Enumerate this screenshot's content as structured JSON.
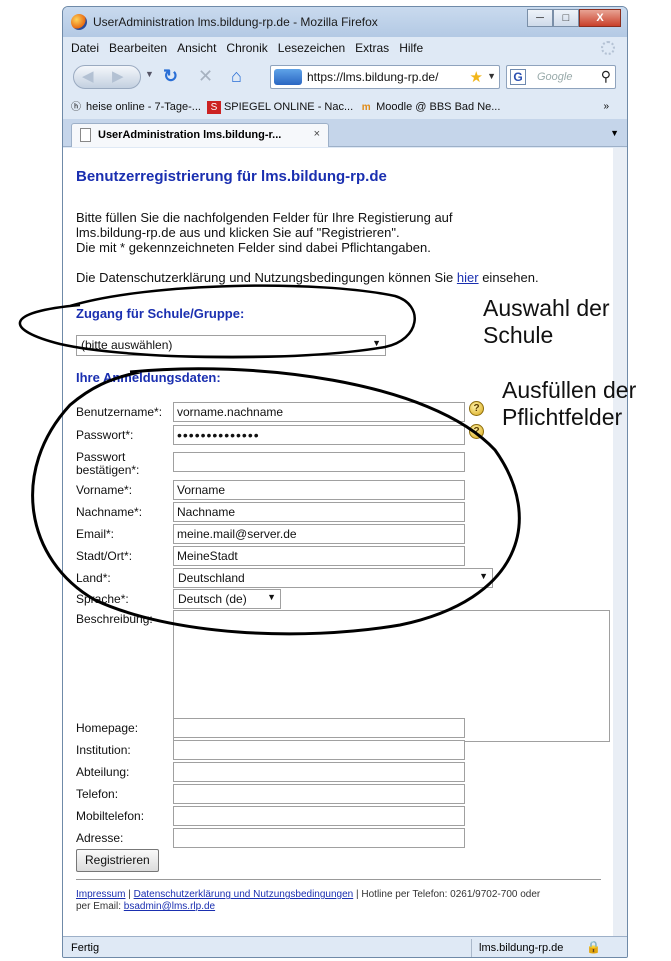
{
  "window": {
    "title": "UserAdministration lms.bildung-rp.de - Mozilla Firefox",
    "controls": [
      "─",
      "□",
      "X"
    ]
  },
  "menubar": {
    "items": [
      {
        "label": "Datei"
      },
      {
        "label": "Bearbeiten"
      },
      {
        "label": "Ansicht"
      },
      {
        "label": "Chronik"
      },
      {
        "label": "Lesezeichen"
      },
      {
        "label": "Extras"
      },
      {
        "label": "Hilfe"
      }
    ]
  },
  "navbar": {
    "url": "https://lms.bildung-rp.de/",
    "search_placeholder": "Google"
  },
  "bookmarks": [
    {
      "label": "heise online - 7-Tage-..."
    },
    {
      "label": "SPIEGEL ONLINE - Nac..."
    },
    {
      "label": "Moodle @ BBS Bad Ne..."
    }
  ],
  "bookmarks_more": "»",
  "tab": {
    "title": "UserAdministration lms.bildung-r...",
    "close": "×"
  },
  "page": {
    "heading": "Benutzerregistrierung für lms.bildung-rp.de",
    "intro_lines": [
      "Bitte füllen Sie die nachfolgenden Felder für Ihre Registierung auf",
      "lms.bildung-rp.de aus und klicken Sie auf \"Registrieren\".",
      "Die mit * gekennzeichneten Felder sind dabei Pflichtangaben."
    ],
    "privacy_text": "Die Datenschutzerklärung und Nutzungsbedingungen können Sie",
    "privacy_link": "hier",
    "privacy_suffix": "einsehen.",
    "school_heading": "Zugang für Schule/Gruppe:",
    "school_select": "(bitte auswählen)",
    "login_heading": "Ihre Anmeldungsdaten:",
    "fields": {
      "username": {
        "label": "Benutzername*:",
        "value": "vorname.nachname"
      },
      "password": {
        "label": "Passwort*:",
        "value": "••••••••••••••"
      },
      "password_confirm": {
        "label_1": "Passwort",
        "label_2": "bestätigen*:",
        "value": ""
      },
      "firstname": {
        "label": "Vorname*:",
        "value": "Vorname"
      },
      "lastname": {
        "label": "Nachname*:",
        "value": "Nachname"
      },
      "email": {
        "label": "Email*:",
        "value": "meine.mail@server.de"
      },
      "city": {
        "label": "Stadt/Ort*:",
        "value": "MeineStadt"
      },
      "country": {
        "label": "Land*:",
        "value": "Deutschland"
      },
      "language": {
        "label": "Sprache*:",
        "value": "Deutsch (de)"
      },
      "description": {
        "label": "Beschreibung:"
      },
      "homepage": {
        "label": "Homepage:"
      },
      "institution": {
        "label": "Institution:"
      },
      "department": {
        "label": "Abteilung:"
      },
      "phone": {
        "label": "Telefon:"
      },
      "mobile": {
        "label": "Mobiltelefon:"
      },
      "address": {
        "label": "Adresse:"
      }
    },
    "submit_label": "Registrieren",
    "help_glyph": "?",
    "footer": {
      "impressum": "Impressum",
      "sep": "|",
      "privacy": "Datenschutzerklärung und Nutzungsbedingungen",
      "hotline": "| Hotline per Telefon: 0261/9702-700 oder",
      "email_prefix": "per Email:",
      "email": "bsadmin@lms.rlp.de"
    }
  },
  "statusbar": {
    "left": "Fertig",
    "right": "lms.bildung-rp.de"
  },
  "annotations": {
    "school": [
      "Auswahl der",
      "Schule"
    ],
    "fields": [
      "Ausfüllen der",
      "Pflichtfelder"
    ]
  },
  "colors": {
    "heading": "#1a2fb0",
    "annotation_ink": "#000000",
    "window_frame": "#dfe9f5"
  }
}
